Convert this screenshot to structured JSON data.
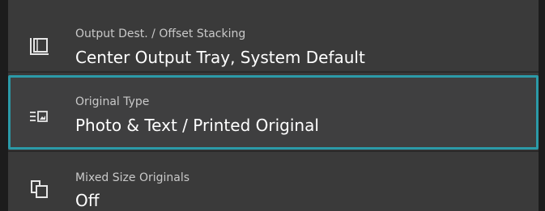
{
  "rows": [
    {
      "label": "Output Dest. / Offset Stacking",
      "value": "Center Output Tray, System Default",
      "icon": "output-tray-icon"
    },
    {
      "label": "Original Type",
      "value": "Photo & Text / Printed Original",
      "icon": "original-type-icon",
      "selected": true
    },
    {
      "label": "Mixed Size Originals",
      "value": "Off",
      "icon": "mixed-size-originals-icon"
    }
  ],
  "colors": {
    "selected_border": "#2b9aa8",
    "row_background": "#3a3a3a",
    "label_text": "#c9c9c9",
    "value_text": "#ffffff"
  }
}
